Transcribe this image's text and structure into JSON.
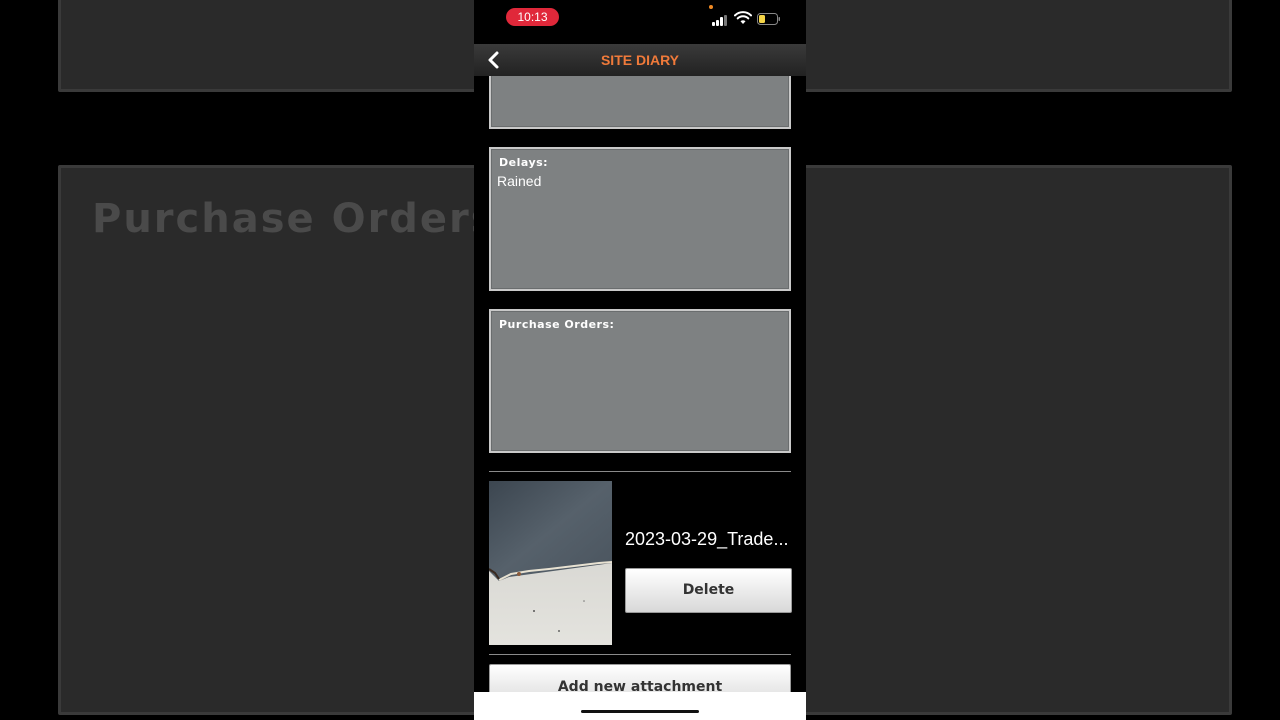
{
  "background": {
    "title": "Purchase Orders:"
  },
  "status_bar": {
    "time": "10:13"
  },
  "nav": {
    "title": "SITE DIARY",
    "back_icon": "chevron-left-icon"
  },
  "fields": {
    "delays": {
      "label": "Delays:",
      "value": "Rained"
    },
    "purchase_orders": {
      "label": "Purchase Orders:",
      "value": ""
    }
  },
  "attachment": {
    "file_name": "2023-03-29_Trade...",
    "delete_label": "Delete"
  },
  "add_attachment_label": "Add new attachment",
  "colors": {
    "accent": "#f07a3a",
    "field_bg": "#7e8182",
    "time_pill": "#e0283a"
  }
}
